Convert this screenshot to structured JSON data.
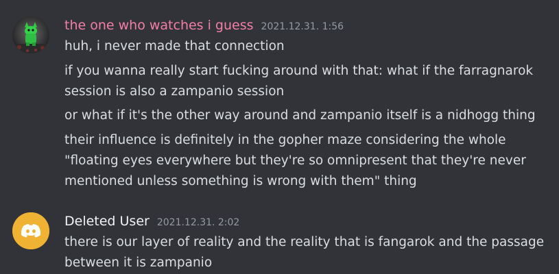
{
  "messages": [
    {
      "username": "the one who watches i guess",
      "username_color": "#f47fa5",
      "timestamp": "2021.12.31. 1:56",
      "avatar_icon": "green-creature-avatar",
      "lines": [
        "huh, i never made that connection",
        "if you wanna really start fucking around with that: what if the farragnarok session is also a zampanio session",
        "or what if it's the other way around and zampanio itself is a nidhogg thing",
        "their influence is definitely in the gopher maze considering the whole \"floating eyes everywhere but they're so omnipresent that they're never mentioned unless something is wrong with them\" thing"
      ]
    },
    {
      "username": "Deleted User",
      "username_color": "#f2f3f5",
      "timestamp": "2021.12.31. 2:02",
      "avatar_icon": "discord-logo-avatar",
      "avatar_color": "#f0b232",
      "lines": [
        "there is our layer of reality and the reality that is fangarok and the passage between it is zampanio"
      ]
    }
  ]
}
